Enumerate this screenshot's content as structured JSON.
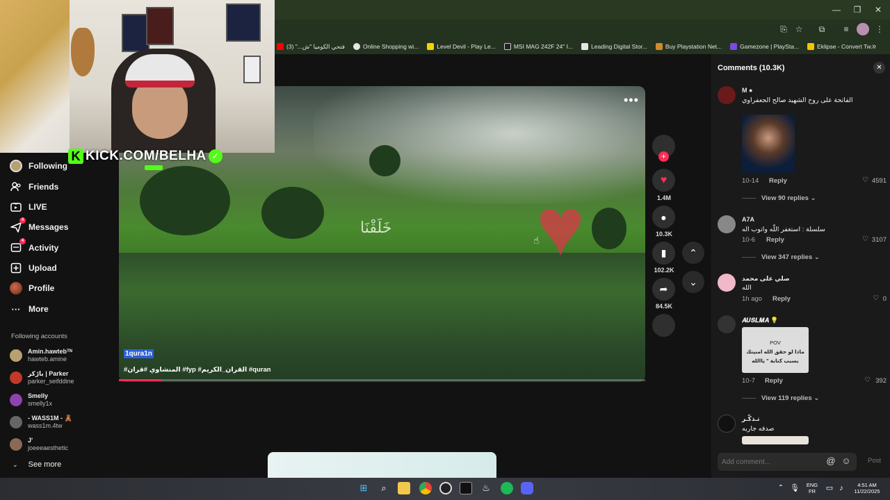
{
  "browser": {
    "bookmarks": [
      {
        "label": "فتحي الكوميا \"ش...\" (3)",
        "color": "#ff0000"
      },
      {
        "label": "Online Shopping wi...",
        "color": "#e5e5e5"
      },
      {
        "label": "Level Devil - Play Le...",
        "color": "#f5d300"
      },
      {
        "label": "MSI MAG 242F 24\" I...",
        "color": "#222222"
      },
      {
        "label": "Leading Digital Stor...",
        "color": "#e5e5e5"
      },
      {
        "label": "Buy Playstation Net...",
        "color": "#d08a2c"
      },
      {
        "label": "Gamezone | PlaySta...",
        "color": "#7a4be0"
      },
      {
        "label": "Eklipse - Convert Tw...",
        "color": "#f5c400"
      }
    ],
    "more_bookmarks": "»"
  },
  "stream_overlay": {
    "kick_url": "KICK.COM/BELHA",
    "kick_logo": "K"
  },
  "sidebar": {
    "nav": [
      {
        "label": "Following",
        "icon": "avatar-icon"
      },
      {
        "label": "Friends",
        "icon": "friends-icon",
        "glyph": "👥"
      },
      {
        "label": "LIVE",
        "icon": "live-icon",
        "glyph": "▣"
      },
      {
        "label": "Messages",
        "icon": "messages-icon",
        "glyph": "✉",
        "badge": "4"
      },
      {
        "label": "Activity",
        "icon": "activity-icon",
        "glyph": "▤",
        "badge": "4"
      },
      {
        "label": "Upload",
        "icon": "upload-icon",
        "glyph": "⊞"
      },
      {
        "label": "Profile",
        "icon": "profile-icon",
        "glyph": "●"
      },
      {
        "label": "More",
        "icon": "more-icon",
        "glyph": "···"
      }
    ],
    "following_accounts_label": "Following accounts",
    "accounts": [
      {
        "name": "Amin.hawtebᵀᴺ",
        "user": "hawteb.amine",
        "color": "#b8a070"
      },
      {
        "name": "بارْكر | Parker",
        "user": "parker_seifddine",
        "color": "#c0392b"
      },
      {
        "name": "Smelly",
        "user": "smelly1x",
        "color": "#8e44ad"
      },
      {
        "name": "- WASS1M - 🧸",
        "user": "wass1m.4tw",
        "color": "#666666"
      },
      {
        "name": "J'",
        "user": "joeeeaesthetic",
        "color": "#8a6a55"
      }
    ],
    "see_more": "See more"
  },
  "video": {
    "author": "1qura1n",
    "caption": "#المنشاوي #قران #fyp #القران_الكريم #quran",
    "overlay_text": "خَلَقْنَا",
    "progress_fraction": 0.08,
    "more_label": "•••"
  },
  "actions": {
    "likes": "1.4M",
    "comments": "10.3K",
    "saves": "102.2K",
    "shares": "84.5K"
  },
  "comments_panel": {
    "title": "Comments (10.3K)",
    "close": "✕",
    "items": [
      {
        "name": "M ●",
        "text": "الفاتحة على روح الشهيد صالح الجعفراوي",
        "date": "10-14",
        "reply": "Reply",
        "likes": "4591",
        "view_replies": "View 90 replies ⌄"
      },
      {
        "name": "A7A",
        "text": "سلسلة : استغفر اللّه واتوب اله",
        "date": "10-6",
        "reply": "Reply",
        "likes": "3107",
        "view_replies": "View 347 replies ⌄"
      },
      {
        "name": "صلي على محمد",
        "text": "الله",
        "date": "1h ago",
        "reply": "Reply",
        "likes": "0"
      },
      {
        "name": "𝑨𝑼𝑺𝑳𝑴𝑨 💡",
        "text": "",
        "date": "10-7",
        "reply": "Reply",
        "likes": "392",
        "view_replies": "View 119 replies ⌄",
        "image_lines": [
          "POV",
          "ماذا لو حقق الله امنيتك",
          "بسبب كتابة \" ياالله"
        ]
      },
      {
        "name": "تـذكّـر",
        "text": "صدقه جاريه"
      }
    ],
    "add_placeholder": "Add comment...",
    "post": "Post",
    "mention_icon": "@",
    "emoji_icon": "☺"
  },
  "taskbar": {
    "lang_top": "ENG",
    "lang_bottom": "FR",
    "time": "4:51 AM",
    "date": "11/22/2025"
  }
}
